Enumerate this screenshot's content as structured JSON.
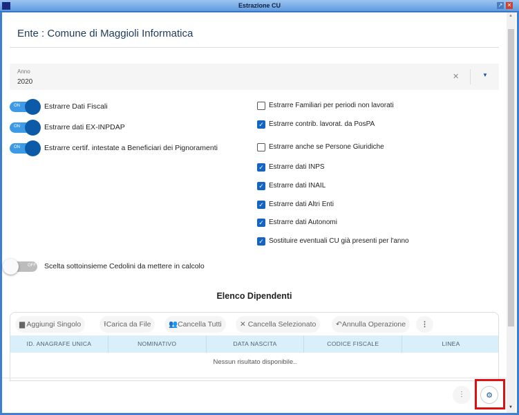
{
  "window": {
    "title": "Estrazione CU"
  },
  "header": {
    "title": "Ente : Comune di Maggioli Informatica"
  },
  "anno": {
    "label": "Anno",
    "value": "2020",
    "clear": "✕",
    "dropdown": "▼"
  },
  "toggles": [
    {
      "label": "Estrarre Dati Fiscali",
      "state": "ON"
    },
    {
      "label": "Estrarre dati EX-INPDAP",
      "state": "ON"
    },
    {
      "label": "Estrarre certif. intestate a Beneficiari dei Pignoramenti",
      "state": "ON"
    },
    {
      "label": "Scelta sottoinsieme Cedolini da mettere in calcolo",
      "state": "OFF"
    }
  ],
  "checkboxes": [
    {
      "label": "Estrarre Familiari per periodi non lavorati",
      "checked": false
    },
    {
      "label": "Estrarre contrib. lavorat. da PosPA",
      "checked": true
    },
    {
      "label": "Estrarre anche se Persone Giuridiche",
      "checked": false
    },
    {
      "label": "Estrarre dati INPS",
      "checked": true
    },
    {
      "label": "Estrarre dati INAIL",
      "checked": true
    },
    {
      "label": "Estrarre dati Altri Enti",
      "checked": true
    },
    {
      "label": "Estrarre dati Autonomi",
      "checked": true
    },
    {
      "label": "Sostituire eventuali CU già presenti per l'anno",
      "checked": true
    }
  ],
  "section": {
    "title": "Elenco Dipendenti"
  },
  "toolbar": {
    "add": "Aggiungi Singolo",
    "upload": "Carica da File",
    "delete_all": "Cancella Tutti",
    "delete_selected": "Cancella Selezionato",
    "undo": "Annulla Operazione"
  },
  "table": {
    "columns": [
      "ID. ANAGRAFE UNICA",
      "NOMINATIVO",
      "DATA NASCITA",
      "CODICE FISCALE",
      "LINEA"
    ],
    "empty": "Nessun risultato disponibile.."
  },
  "colors": {
    "accent": "#1565c0",
    "highlight": "#e01010"
  }
}
